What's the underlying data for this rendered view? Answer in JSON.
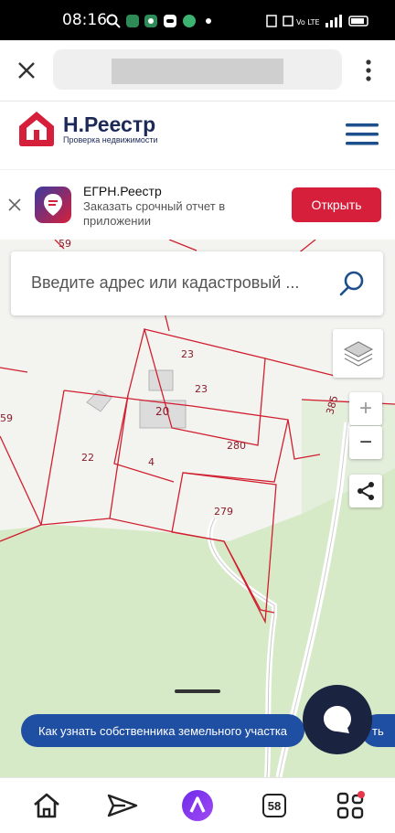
{
  "status_bar": {
    "time": "08:16"
  },
  "browser": {
    "close_icon": "close-icon",
    "url": "",
    "menu_icon": "more-vertical-icon"
  },
  "site_header": {
    "title": "Н.Реестр",
    "subtitle": "Проверка недвижимости",
    "menu_icon": "hamburger-icon"
  },
  "app_banner": {
    "title": "ЕГРН.Реестр",
    "description": "Заказать срочный отчет в приложении",
    "open_label": "Открыть"
  },
  "search": {
    "placeholder": "Введите адрес или кадастровый ..."
  },
  "map": {
    "zoom_in_label": "+",
    "zoom_out_label": "−",
    "parcel_labels": [
      "59",
      "23",
      "23",
      "20",
      "22",
      "4",
      "280",
      "279",
      "59",
      "385"
    ]
  },
  "promo": {
    "label": "Как узнать собственника земельного участка"
  },
  "bottom_nav": {
    "tab_count": "58"
  }
}
